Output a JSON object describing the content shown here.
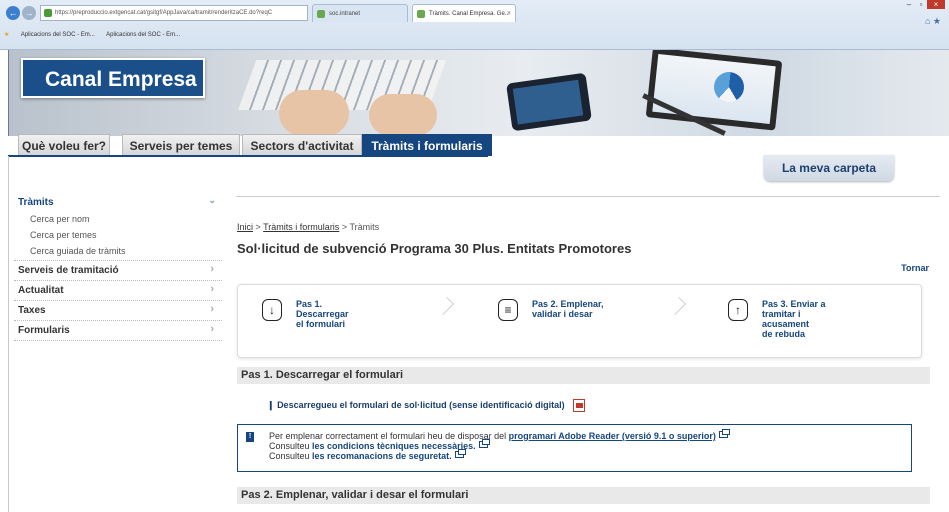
{
  "browser": {
    "url": "https://preproduccio.extgencat.cat/gsitgf/AppJava/ca/tramit/renderitzaCE.do?reqC",
    "tabs": [
      {
        "label": "soc.intranet"
      },
      {
        "label": "Tràmits. Canal Empresa. Ge..."
      }
    ],
    "favorites": [
      "Aplicacions del SOC - Em...",
      "Aplicacions del SOC - Em..."
    ]
  },
  "brand": "Canal Empresa",
  "topnav": [
    "Què voleu fer?",
    "Serveis per temes",
    "Sectors d'activitat",
    "Tràmits i formularis"
  ],
  "carpeta": "La meva carpeta",
  "sidebar": {
    "tramits": "Tràmits",
    "sub": [
      "Cerca per nom",
      "Cerca per temes",
      "Cerca guiada de tràmits"
    ],
    "items": [
      "Serveis de tramitació",
      "Actualitat",
      "Taxes",
      "Formularis"
    ]
  },
  "breadcrumb": {
    "home": "Inici",
    "mid": "Tràmits i formularis",
    "current": "Tràmits",
    "sep": ">"
  },
  "title": "Sol·licitud de subvenció Programa 30 Plus. Entitats Promotores",
  "tornar": "Tornar",
  "steps": [
    {
      "line1": "Pas 1.",
      "line2": "Descarregar",
      "line3": "el formulari",
      "line4": ""
    },
    {
      "line1": "Pas 2. Emplenar,",
      "line2": "validar i desar",
      "line3": "",
      "line4": ""
    },
    {
      "line1": "Pas 3. Enviar a",
      "line2": "tramitar i",
      "line3": "acusament",
      "line4": "de rebuda"
    }
  ],
  "section1": "Pas 1. Descarregar el formulari",
  "download_link": "Descarregueu el formulari de sol·licitud (sense identificació digital)",
  "notice": {
    "line1_pre": "Per emplenar correctament el formulari heu de disposar del ",
    "line1_link": "programari Adobe Reader (versió 9.1 o superior)",
    "line2_pre": "Consulteu ",
    "line2_link": "les condicions tècniques necessàries.",
    "line3_pre": "Consulteu ",
    "line3_link": "les recomanacions de seguretat."
  },
  "section2": "Pas 2. Emplenar, validar i desar el formulari"
}
